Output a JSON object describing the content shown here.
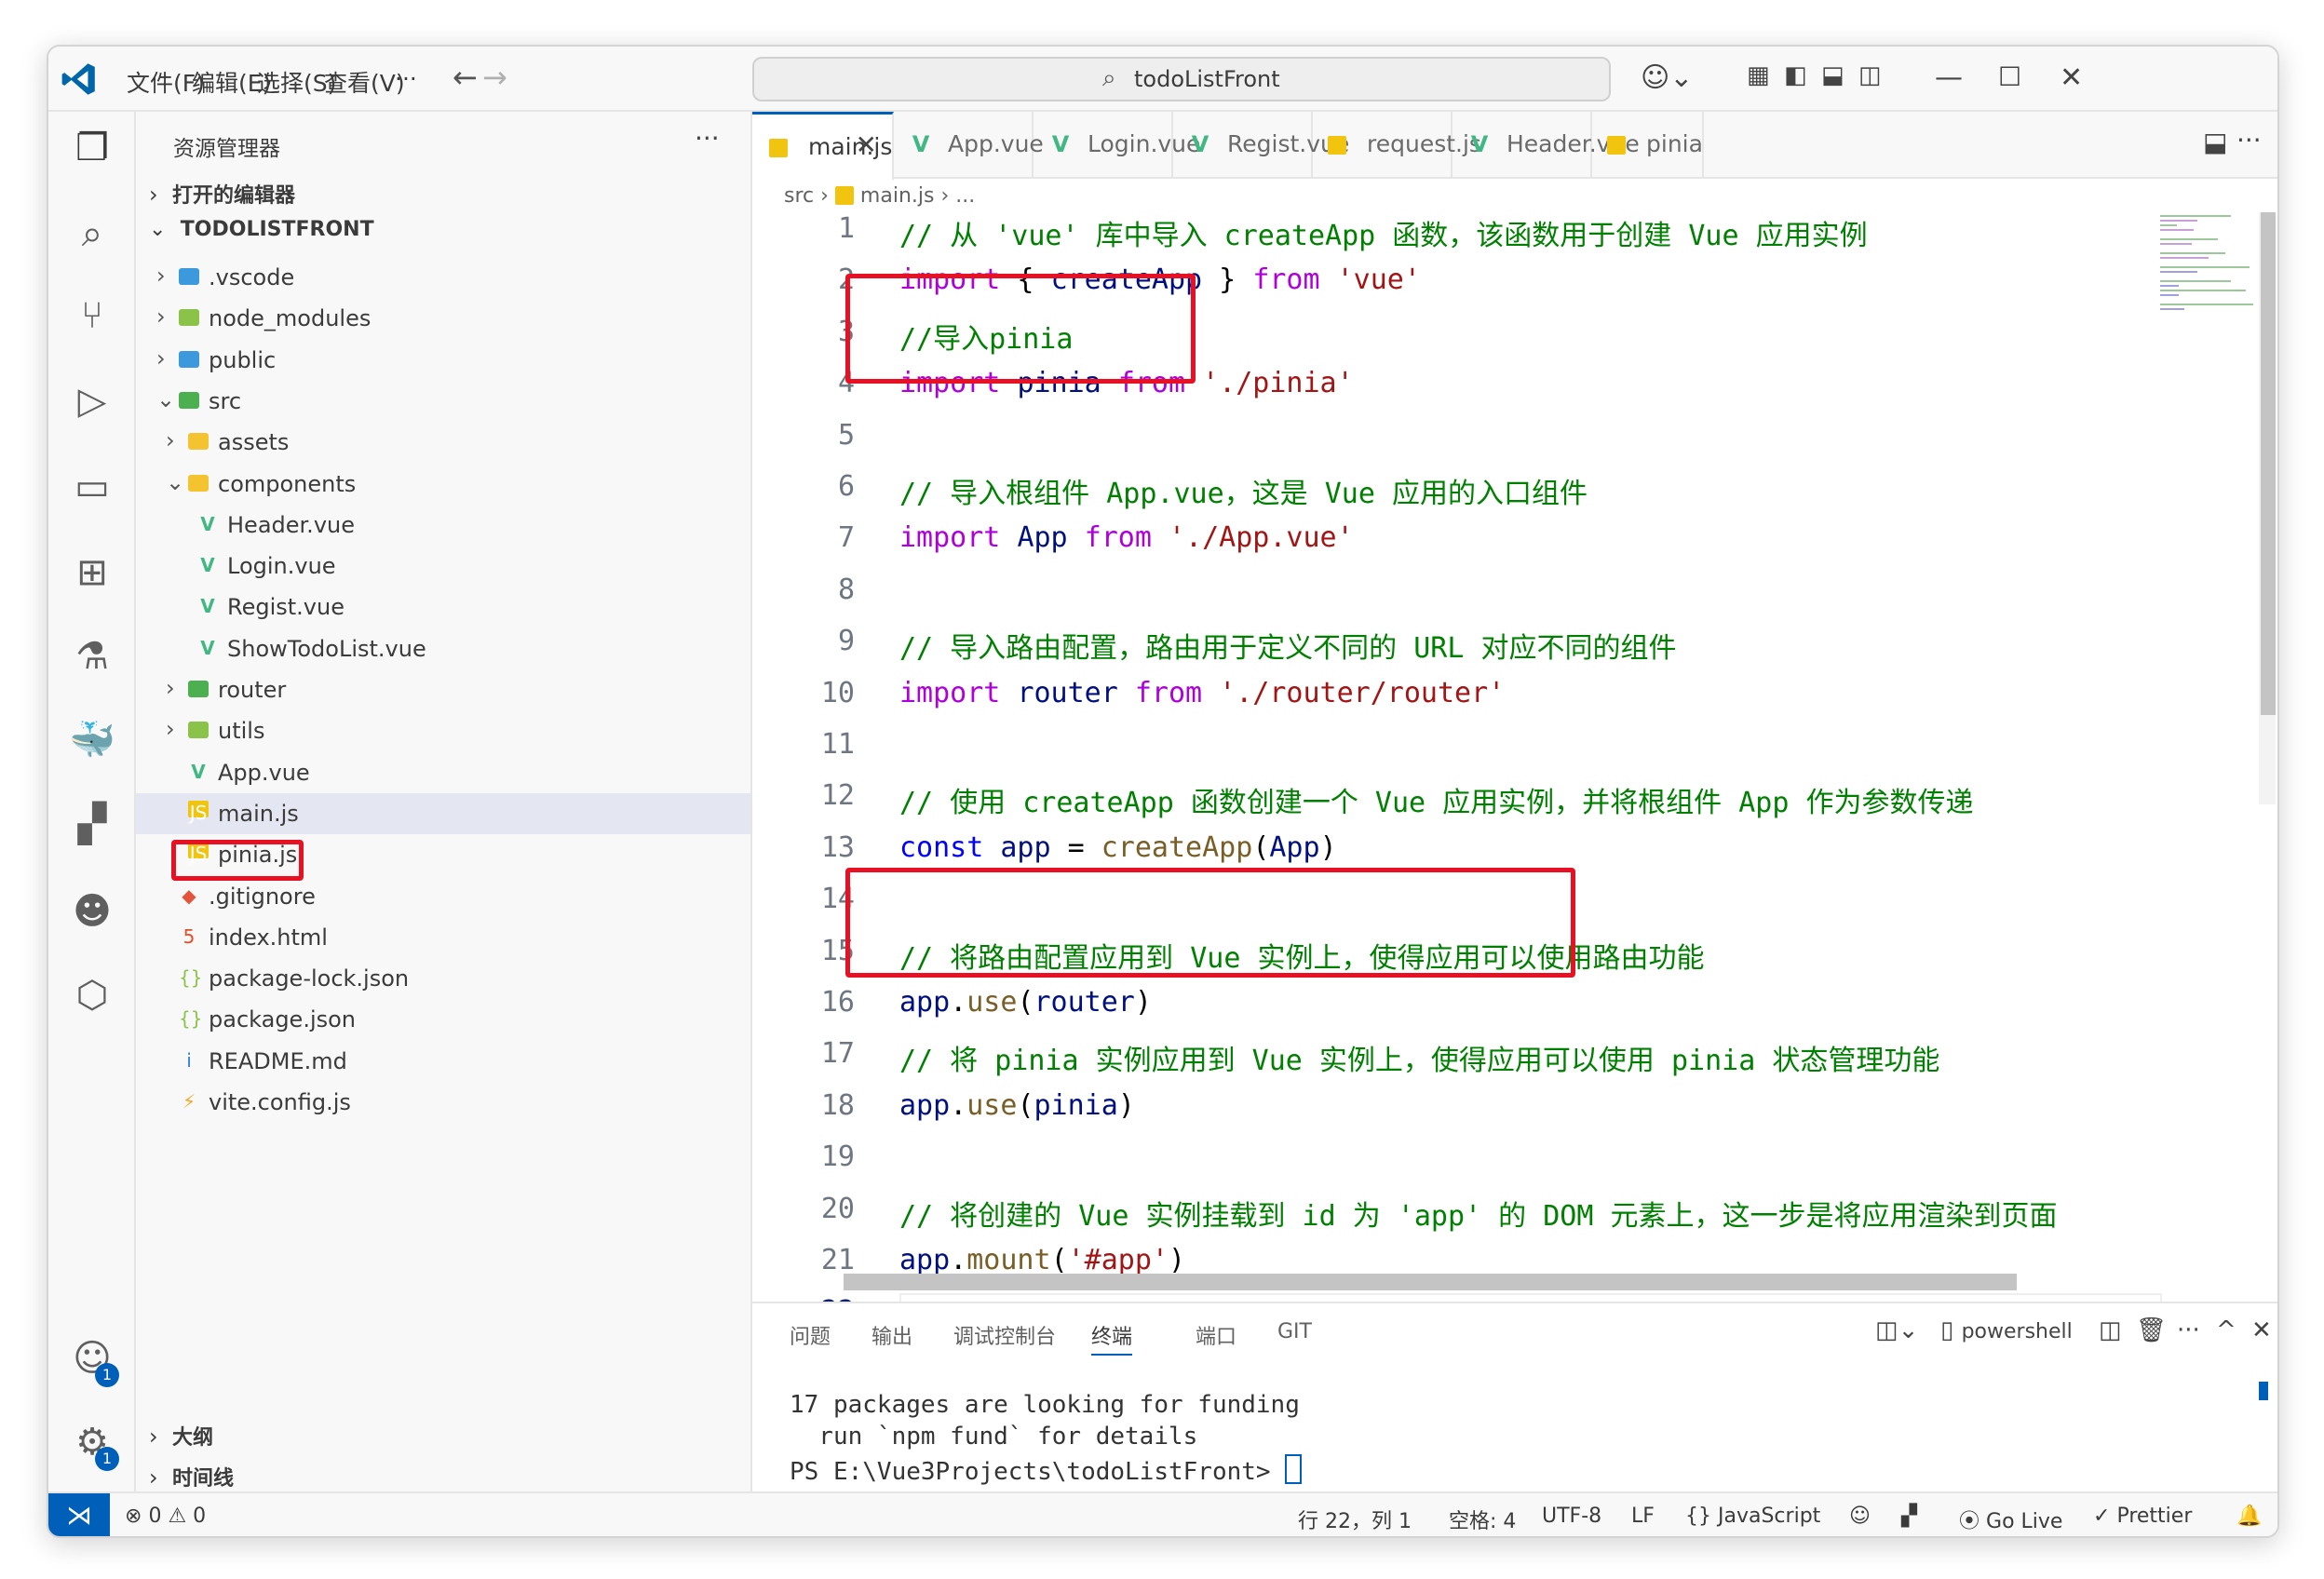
{
  "titlebar": {
    "menus": [
      "文件(F)",
      "编辑(E)",
      "选择(S)",
      "查看(V)",
      "···"
    ],
    "search_text": "todoListFront"
  },
  "explorer": {
    "title": "资源管理器",
    "open_editors": "打开的编辑器",
    "project": "TODOLISTFRONT",
    "tree": [
      {
        "name": ".vscode",
        "type": "folder",
        "depth": 1,
        "chevron": "›"
      },
      {
        "name": "node_modules",
        "type": "folder",
        "depth": 1,
        "chevron": "›"
      },
      {
        "name": "public",
        "type": "folder",
        "depth": 1,
        "chevron": "›"
      },
      {
        "name": "src",
        "type": "folder",
        "depth": 1,
        "chevron": "⌄"
      },
      {
        "name": "assets",
        "type": "folder",
        "depth": 2,
        "chevron": "›"
      },
      {
        "name": "components",
        "type": "folder",
        "depth": 2,
        "chevron": "⌄"
      },
      {
        "name": "Header.vue",
        "type": "vue",
        "depth": 3
      },
      {
        "name": "Login.vue",
        "type": "vue",
        "depth": 3
      },
      {
        "name": "Regist.vue",
        "type": "vue",
        "depth": 3
      },
      {
        "name": "ShowTodoList.vue",
        "type": "vue",
        "depth": 3
      },
      {
        "name": "router",
        "type": "folder",
        "depth": 2,
        "chevron": "›"
      },
      {
        "name": "utils",
        "type": "folder",
        "depth": 2,
        "chevron": "›"
      },
      {
        "name": "App.vue",
        "type": "vue",
        "depth": 2
      },
      {
        "name": "main.js",
        "type": "js",
        "depth": 2,
        "selected": true
      },
      {
        "name": "pinia.js",
        "type": "js",
        "depth": 2
      },
      {
        "name": ".gitignore",
        "type": "git",
        "depth": 1
      },
      {
        "name": "index.html",
        "type": "html",
        "depth": 1
      },
      {
        "name": "package-lock.json",
        "type": "json",
        "depth": 1
      },
      {
        "name": "package.json",
        "type": "json",
        "depth": 1
      },
      {
        "name": "README.md",
        "type": "info",
        "depth": 1
      },
      {
        "name": "vite.config.js",
        "type": "vite",
        "depth": 1
      }
    ],
    "outline": "大纲",
    "timeline": "时间线"
  },
  "tabs": [
    {
      "label": "main.js",
      "type": "js",
      "active": true
    },
    {
      "label": "App.vue",
      "type": "vue"
    },
    {
      "label": "Login.vue",
      "type": "vue"
    },
    {
      "label": "Regist.vue",
      "type": "vue"
    },
    {
      "label": "request.js",
      "type": "js"
    },
    {
      "label": "Header.vue",
      "type": "vue"
    },
    {
      "label": "pinia",
      "type": "js"
    }
  ],
  "breadcrumb": {
    "folder": "src",
    "file": "main.js",
    "rest": "..."
  },
  "code_lines": [
    [
      [
        "c-com",
        "// 从 'vue' 库中导入 createApp 函数，该函数用于创建 Vue 应用实例"
      ]
    ],
    [
      [
        "c-kw",
        "import"
      ],
      [
        "c-plain",
        " { "
      ],
      [
        "c-var",
        "createApp"
      ],
      [
        "c-plain",
        " } "
      ],
      [
        "c-kw",
        "from"
      ],
      [
        "c-plain",
        " "
      ],
      [
        "c-str",
        "'vue'"
      ]
    ],
    [
      [
        "c-com",
        "//导入pinia"
      ]
    ],
    [
      [
        "c-kw",
        "import"
      ],
      [
        "c-plain",
        " "
      ],
      [
        "c-var",
        "pinia"
      ],
      [
        "c-plain",
        " "
      ],
      [
        "c-kw",
        "from"
      ],
      [
        "c-plain",
        " "
      ],
      [
        "c-str",
        "'./pinia'"
      ]
    ],
    [],
    [
      [
        "c-com",
        "// 导入根组件 App.vue，这是 Vue 应用的入口组件"
      ]
    ],
    [
      [
        "c-kw",
        "import"
      ],
      [
        "c-plain",
        " "
      ],
      [
        "c-var",
        "App"
      ],
      [
        "c-plain",
        " "
      ],
      [
        "c-kw",
        "from"
      ],
      [
        "c-plain",
        " "
      ],
      [
        "c-str",
        "'./App.vue'"
      ]
    ],
    [],
    [
      [
        "c-com",
        "// 导入路由配置，路由用于定义不同的 URL 对应不同的组件"
      ]
    ],
    [
      [
        "c-kw",
        "import"
      ],
      [
        "c-plain",
        " "
      ],
      [
        "c-var",
        "router"
      ],
      [
        "c-plain",
        " "
      ],
      [
        "c-kw",
        "from"
      ],
      [
        "c-plain",
        " "
      ],
      [
        "c-str",
        "'./router/router'"
      ]
    ],
    [],
    [
      [
        "c-com",
        "// 使用 createApp 函数创建一个 Vue 应用实例，并将根组件 App 作为参数传递"
      ]
    ],
    [
      [
        "c-dec",
        "const"
      ],
      [
        "c-plain",
        " "
      ],
      [
        "c-var",
        "app"
      ],
      [
        "c-plain",
        " = "
      ],
      [
        "c-fn",
        "createApp"
      ],
      [
        "c-plain",
        "("
      ],
      [
        "c-var",
        "App"
      ],
      [
        "c-plain",
        ")"
      ]
    ],
    [],
    [
      [
        "c-com",
        "// 将路由配置应用到 Vue 实例上，使得应用可以使用路由功能"
      ]
    ],
    [
      [
        "c-var",
        "app"
      ],
      [
        "c-plain",
        "."
      ],
      [
        "c-fn",
        "use"
      ],
      [
        "c-plain",
        "("
      ],
      [
        "c-var",
        "router"
      ],
      [
        "c-plain",
        ")"
      ]
    ],
    [
      [
        "c-com",
        "// 将 pinia 实例应用到 Vue 实例上，使得应用可以使用 pinia 状态管理功能"
      ]
    ],
    [
      [
        "c-var",
        "app"
      ],
      [
        "c-plain",
        "."
      ],
      [
        "c-fn",
        "use"
      ],
      [
        "c-plain",
        "("
      ],
      [
        "c-var",
        "pinia"
      ],
      [
        "c-plain",
        ")"
      ]
    ],
    [],
    [
      [
        "c-com",
        "// 将创建的 Vue 实例挂载到 id 为 'app' 的 DOM 元素上，这一步是将应用渲染到页面"
      ]
    ],
    [
      [
        "c-var",
        "app"
      ],
      [
        "c-plain",
        "."
      ],
      [
        "c-fn",
        "mount"
      ],
      [
        "c-plain",
        "("
      ],
      [
        "c-str",
        "'#app'"
      ],
      [
        "c-plain",
        ")"
      ]
    ],
    [],
    []
  ],
  "current_line": 22,
  "panel": {
    "tabs": [
      "问题",
      "输出",
      "调试控制台",
      "终端",
      "端口",
      "GIT"
    ],
    "active_tab": "终端",
    "shell": "powershell",
    "terminal": [
      "17 packages are looking for funding",
      "  run `npm fund` for details",
      "PS E:\\Vue3Projects\\todoListFront> "
    ]
  },
  "statusbar": {
    "errors": "0",
    "warnings": "0",
    "position": "行 22，列 1",
    "spaces": "空格: 4",
    "encoding": "UTF-8",
    "eol": "LF",
    "language": "JavaScript",
    "golive": "Go Live",
    "prettier": "Prettier"
  },
  "badges": {
    "accounts": "1",
    "settings": "1"
  },
  "colors": {
    "accent": "#005fb8",
    "highlight_box": "#e81123",
    "comment": "#008000",
    "keyword": "#af00db",
    "string": "#a31515"
  }
}
